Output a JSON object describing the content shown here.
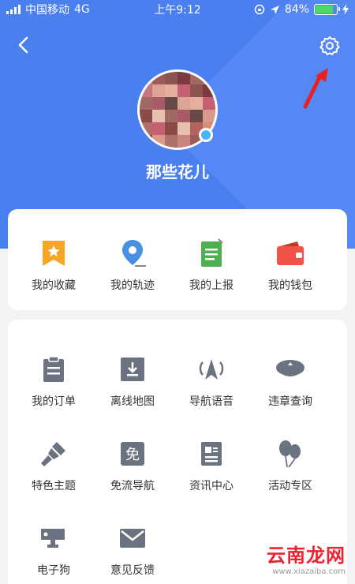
{
  "status_bar": {
    "carrier": "中国移动",
    "network": "4G",
    "time": "上午9:12",
    "battery_text": "84%",
    "battery_level": 0.84
  },
  "profile": {
    "username": "那些花儿"
  },
  "colors": {
    "header_bg": "#4a7ff0",
    "annotation_arrow": "#e8231f"
  },
  "quick_actions": [
    {
      "label": "我的收藏",
      "icon": "bookmark-star-icon",
      "color": "#f5a623"
    },
    {
      "label": "我的轨迹",
      "icon": "location-pin-icon",
      "color": "#4a90e2"
    },
    {
      "label": "我的上报",
      "icon": "report-document-icon",
      "color": "#4caf50"
    },
    {
      "label": "我的钱包",
      "icon": "wallet-icon",
      "color": "#f0524a"
    }
  ],
  "services": [
    {
      "label": "我的订单",
      "icon": "order-clipboard-icon"
    },
    {
      "label": "离线地图",
      "icon": "offline-map-download-icon"
    },
    {
      "label": "导航语音",
      "icon": "navigation-voice-icon"
    },
    {
      "label": "违章查询",
      "icon": "police-cap-icon"
    },
    {
      "label": "特色主题",
      "icon": "paint-brush-icon"
    },
    {
      "label": "免流导航",
      "icon": "free-data-icon",
      "glyph": "免"
    },
    {
      "label": "资讯中心",
      "icon": "news-icon"
    },
    {
      "label": "活动专区",
      "icon": "balloons-icon"
    },
    {
      "label": "电子狗",
      "icon": "camera-icon"
    },
    {
      "label": "意见反馈",
      "icon": "mail-icon"
    }
  ],
  "watermark": {
    "main": "云南龙网",
    "sub": "www.xiazaiba.com"
  }
}
